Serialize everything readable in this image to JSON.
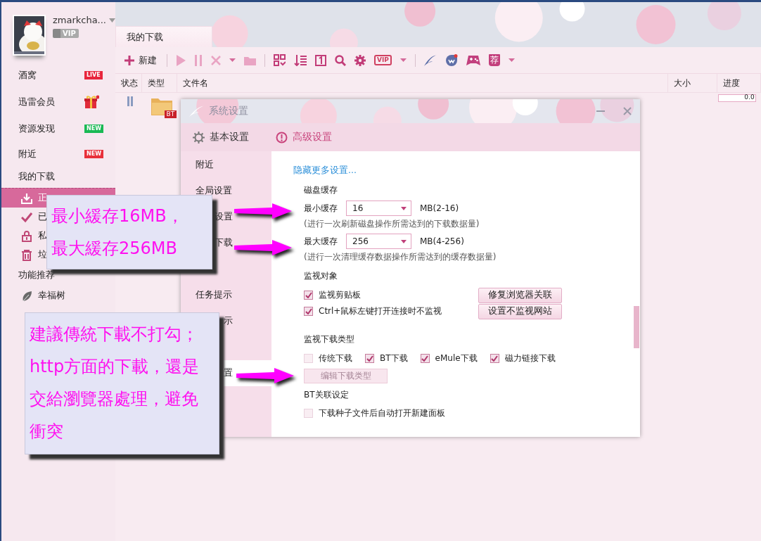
{
  "account": {
    "username": "zmarkcha...",
    "vip": "VIP"
  },
  "sidebar": {
    "items": [
      {
        "kind": "badge",
        "label": "酒窝",
        "badge": "LIVE",
        "color": "#e8253c"
      },
      {
        "kind": "gift",
        "label": "迅雷会员"
      },
      {
        "kind": "badge",
        "label": "资源发现",
        "badge": "NEW",
        "color": "#19b954"
      },
      {
        "kind": "badge",
        "label": "附近",
        "badge": "NEW",
        "color": "#e8303a"
      },
      {
        "kind": "section",
        "label": "我的下载"
      },
      {
        "kind": "download",
        "label": "正",
        "selected": true
      },
      {
        "kind": "done",
        "label": "已",
        "selected": false
      },
      {
        "kind": "private",
        "label": "私",
        "selected": false
      },
      {
        "kind": "trash",
        "label": "垃",
        "selected": false
      },
      {
        "kind": "section",
        "label": "功能推荐"
      },
      {
        "kind": "tree",
        "label": "幸福树",
        "selected": false
      }
    ]
  },
  "tabs": [
    {
      "label": "我的下载",
      "selected": true
    }
  ],
  "toolbar": {
    "new_label": "新建",
    "vip_label": "VIP",
    "recommend_label": "荐"
  },
  "table": {
    "columns": [
      "状态",
      "类型",
      "文件名",
      "大小",
      "进度"
    ],
    "rows": [
      {
        "paused": true,
        "file_type": "BT",
        "progress": {
          "level": 0,
          "reading": "0.0"
        }
      }
    ]
  },
  "dialog": {
    "title": "系统设置",
    "tabs": [
      {
        "kind": "basic",
        "label": "基本设置",
        "selected": false
      },
      {
        "kind": "advanced",
        "label": "高级设置",
        "selected": true
      }
    ],
    "nav": [
      {
        "label": "附近",
        "selected": false
      },
      {
        "label": "全局设置",
        "selected": false
      },
      {
        "label": "设置",
        "selected": false
      },
      {
        "label": "下载",
        "selected": false
      },
      {
        "label": "任务提示",
        "selected": false
      },
      {
        "label": "示",
        "selected": false
      },
      {
        "label": "置",
        "selected": true
      }
    ],
    "more_link": "隐藏更多设置...",
    "sections": [
      {
        "title": "磁盘缓存",
        "rows": [
          {
            "kind": "select",
            "label": "最小缓存",
            "value": "16",
            "range": "MB(2-16)",
            "hint": "(进行一次刷新磁盘操作所需达到的下载数据量)"
          },
          {
            "kind": "select",
            "label": "最大缓存",
            "value": "256",
            "range": "MB(4-256)",
            "hint": "(进行一次清理缓存数据操作所需达到的缓存数据量)"
          }
        ]
      },
      {
        "title": "监视对象",
        "rows": [
          {
            "kind": "checkbox",
            "label": "监视剪贴板",
            "checked": true,
            "button": "修复浏览器关联"
          },
          {
            "kind": "checkbox",
            "label": "Ctrl+鼠标左键打开连接时不监视",
            "checked": true,
            "button": "设置不监视网站"
          }
        ]
      },
      {
        "title": "监视下载类型",
        "rows": [
          {
            "kind": "checkgroup",
            "items": [
              {
                "label": "传统下载",
                "checked": false
              },
              {
                "label": "BT下载",
                "checked": true
              },
              {
                "label": "eMule下载",
                "checked": true
              },
              {
                "label": "磁力链接下载",
                "checked": true
              }
            ]
          },
          {
            "kind": "button",
            "label": "编辑下载类型",
            "disabled": true
          }
        ]
      },
      {
        "title": "BT关联设定",
        "rows": [
          {
            "kind": "checkbox",
            "label": "下载种子文件后自动打开新建面板",
            "checked": false
          }
        ]
      }
    ]
  },
  "annotations": [
    {
      "text": "最小緩存16MB，最大緩存256MB"
    },
    {
      "text": "建議傳統下載不打勾；http方面的下載，還是交給瀏覽器處理，避免衝突"
    }
  ]
}
